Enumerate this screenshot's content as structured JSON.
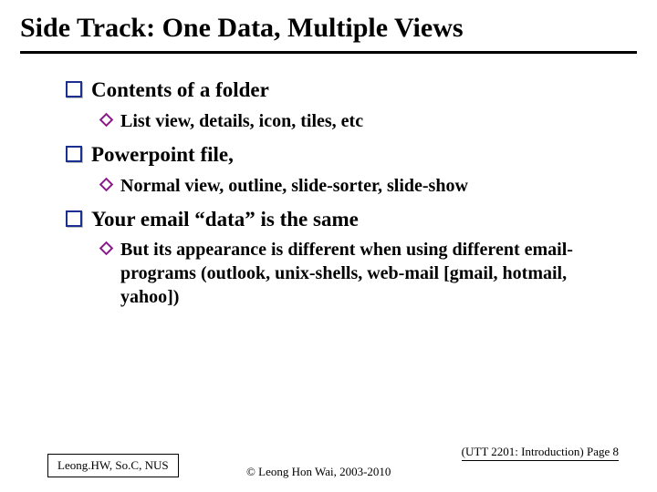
{
  "title": "Side Track: One Data, Multiple Views",
  "items": [
    {
      "label": "Contents of a folder",
      "sub": "List view, details, icon, tiles, etc"
    },
    {
      "label": "Powerpoint file,",
      "sub": "Normal view, outline, slide-sorter, slide-show"
    },
    {
      "label": "Your email “data” is the same",
      "sub": "But its appearance is different when using different email-programs (outlook, unix-shells, web-mail [gmail, hotmail, yahoo])"
    }
  ],
  "footer": {
    "author": "Leong.HW, So.C, NUS",
    "copyright": "© Leong Hon Wai, 2003-2010",
    "pageref": "(UTT 2201: Introduction) Page 8"
  }
}
